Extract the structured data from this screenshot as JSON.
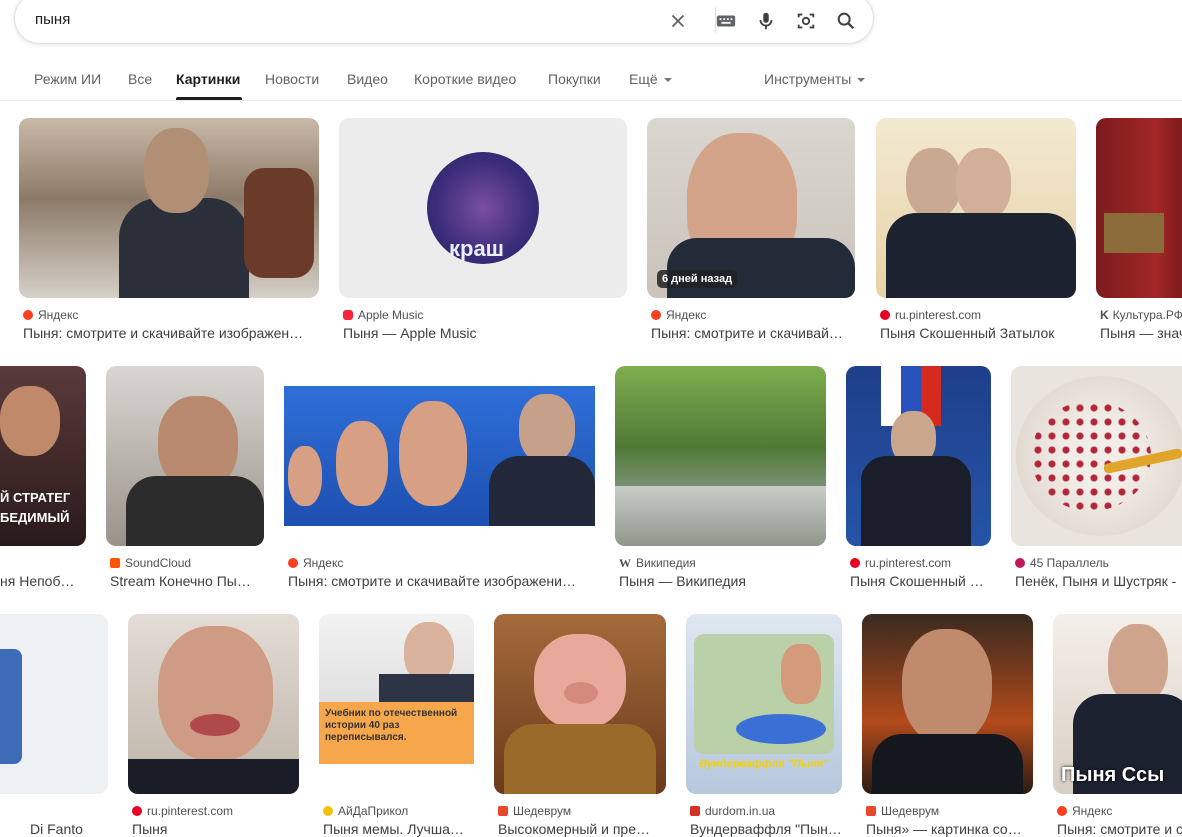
{
  "search": {
    "query": "пыня"
  },
  "tabs": [
    "Режим ИИ",
    "Все",
    "Картинки",
    "Новости",
    "Видео",
    "Короткие видео",
    "Покупки",
    "Ещё"
  ],
  "tools_label": "Инструменты",
  "results": [
    {
      "source": "Яндекс",
      "title": "Пыня: смотрите и скачивайте изображен…",
      "fav": "#fc3f1d"
    },
    {
      "source": "Apple Music",
      "title": "Пыня — Apple Music",
      "fav": "#fa233b"
    },
    {
      "source": "Яндекс",
      "title": "Пыня: смотрите и скачивай…",
      "fav": "#fc3f1d",
      "badge": "6 дней назад"
    },
    {
      "source": "ru.pinterest.com",
      "title": "Пыня Скошенный Затылок",
      "fav": "#e60023"
    },
    {
      "source": "Культура.РФ",
      "title": "Пыня — знач",
      "fav": "#1f1f1f"
    },
    {
      "source": "",
      "title": "ня Непоб…",
      "fav": "#ffffff",
      "overlay1": "Й СТРАТЕГ",
      "overlay2": "БЕДИМЫЙ"
    },
    {
      "source": "SoundCloud",
      "title": "Stream Конечно Пы…",
      "fav": "#ff5500"
    },
    {
      "source": "Яндекс",
      "title": "Пыня: смотрите и скачивайте изображени…",
      "fav": "#fc3f1d"
    },
    {
      "source": "Википедия",
      "title": "Пыня — Википедия",
      "fav": "#ffffff"
    },
    {
      "source": "ru.pinterest.com",
      "title": "Пыня Скошенный …",
      "fav": "#e60023"
    },
    {
      "source": "45 Параллель",
      "title": "Пенёк, Пыня и Шустряк -",
      "fav": "#c2185b"
    },
    {
      "source": "",
      "title": "Di Fanto",
      "fav": "#ffffff"
    },
    {
      "source": "ru.pinterest.com",
      "title": "Пыня",
      "fav": "#e60023"
    },
    {
      "source": "АйДаПрикол",
      "title": "Пыня мемы. Лучша…",
      "fav": "#f4c20d",
      "quote": "Учебник по отечественной истории 40 раз переписывался."
    },
    {
      "source": "Шедеврум",
      "title": "Высокомерный и пре…",
      "fav": "#e8472c"
    },
    {
      "source": "durdom.in.ua",
      "title": "Вундерваффля \"Пын…",
      "fav": "#d93025",
      "caption": "Вундерваффля \"Пыня\""
    },
    {
      "source": "Шедеврум",
      "title": "Пыня» — картинка со…",
      "fav": "#e8472c"
    },
    {
      "source": "Яндекс",
      "title": "Пыня: смотрите и с",
      "fav": "#fc3f1d",
      "caption": "Пыня Ссы"
    }
  ]
}
